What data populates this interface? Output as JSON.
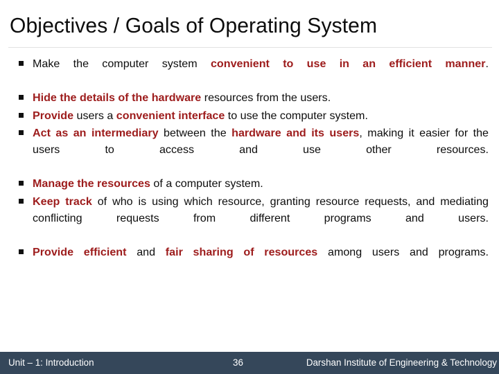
{
  "slide": {
    "title": "Objectives / Goals of Operating System",
    "background_color": "#FFFFFF",
    "emphasis_color": "#9D1C1C",
    "text_color": "#0D0D0D",
    "bullet_marker": "black-square-bullet",
    "bullets": [
      {
        "id": "bullet-1",
        "plain_text": "Make the computer system convenient to use in an efficient manner.",
        "runs": [
          {
            "text": "Make the computer system ",
            "emphasis": false
          },
          {
            "text": "convenient to use in an efficient manner",
            "emphasis": true
          },
          {
            "text": ".",
            "emphasis": false
          }
        ]
      },
      {
        "id": "bullet-2",
        "plain_text": "Hide the details of the hardware resources from the users.",
        "runs": [
          {
            "text": "Hide the details of the hardware",
            "emphasis": true
          },
          {
            "text": " resources from the users.",
            "emphasis": false
          }
        ]
      },
      {
        "id": "bullet-3",
        "plain_text": "Provide users a convenient interface to use the computer system.",
        "runs": [
          {
            "text": "Provide",
            "emphasis": true
          },
          {
            "text": " users a ",
            "emphasis": false
          },
          {
            "text": "convenient interface",
            "emphasis": true
          },
          {
            "text": " to use the computer system.",
            "emphasis": false
          }
        ]
      },
      {
        "id": "bullet-4",
        "plain_text": "Act as an intermediary between the hardware and its users, making it easier for the users to access and use other resources.",
        "runs": [
          {
            "text": "Act as an intermediary",
            "emphasis": true
          },
          {
            "text": " between the ",
            "emphasis": false
          },
          {
            "text": "hardware and its users",
            "emphasis": true
          },
          {
            "text": ", making it easier for the users to access and use other resources.",
            "emphasis": false
          }
        ]
      },
      {
        "id": "bullet-5",
        "plain_text": "Manage the resources of a computer system.",
        "runs": [
          {
            "text": "Manage the resources",
            "emphasis": true
          },
          {
            "text": " of a computer system.",
            "emphasis": false
          }
        ]
      },
      {
        "id": "bullet-6",
        "plain_text": "Keep track of who is using which resource, granting resource requests, and mediating conflicting requests from different programs and users.",
        "runs": [
          {
            "text": "Keep track",
            "emphasis": true
          },
          {
            "text": " of who is using which resource, granting resource requests, and mediating conflicting requests from different programs and users.",
            "emphasis": false
          }
        ]
      },
      {
        "id": "bullet-7",
        "plain_text": "Provide efficient and fair sharing of resources among users and programs.",
        "runs": [
          {
            "text": "Provide efficient",
            "emphasis": true
          },
          {
            "text": " and ",
            "emphasis": false
          },
          {
            "text": "fair sharing of resources",
            "emphasis": true
          },
          {
            "text": " among users and programs.",
            "emphasis": false
          }
        ]
      }
    ]
  },
  "footer": {
    "unit_label": "Unit – 1: Introduction",
    "page_number": "36",
    "institute": "Darshan Institute of Engineering & Technology",
    "background_color": "#35475A",
    "text_color": "#FFFFFF"
  }
}
